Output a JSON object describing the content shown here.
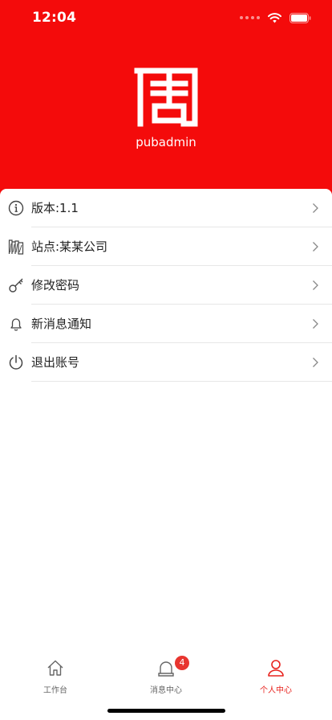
{
  "status_bar": {
    "time": "12:04"
  },
  "header": {
    "username": "pubadmin",
    "background": "#f40b0b"
  },
  "menu": [
    {
      "label": "版本:1.1",
      "icon": "info-icon"
    },
    {
      "label": "站点:某某公司",
      "icon": "building-icon"
    },
    {
      "label": "修改密码",
      "icon": "key-icon"
    },
    {
      "label": "新消息通知",
      "icon": "bell-icon"
    },
    {
      "label": "退出账号",
      "icon": "power-icon"
    }
  ],
  "tabbar": {
    "tabs": [
      {
        "label": "工作台",
        "icon": "home-icon"
      },
      {
        "label": "消息中心",
        "icon": "message-bell-icon",
        "badge": "4"
      },
      {
        "label": "个人中心",
        "icon": "person-icon"
      }
    ],
    "active_color": "#e8231e"
  }
}
